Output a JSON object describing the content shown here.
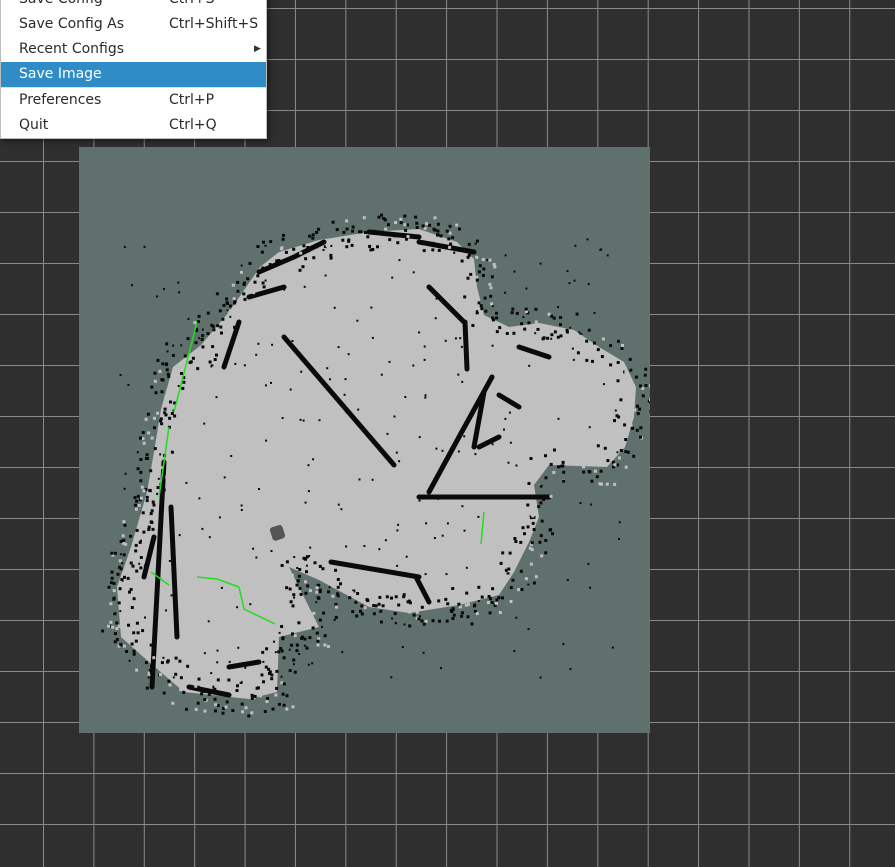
{
  "menu": {
    "items": [
      {
        "label": "Save Config",
        "shortcut": "Ctrl+S"
      },
      {
        "label": "Save Config As",
        "shortcut": "Ctrl+Shift+S"
      },
      {
        "label": "Recent Configs",
        "shortcut": "",
        "submenu": true
      },
      {
        "label": "Save Image",
        "shortcut": "",
        "highlighted": true
      },
      {
        "label": "Preferences",
        "shortcut": "Ctrl+P"
      },
      {
        "label": "Quit",
        "shortcut": "Ctrl+Q"
      }
    ]
  },
  "map": {
    "background_color": "#5f706d",
    "free_color": "#c0c0c0",
    "occupied_color": "#0a0a0a",
    "path_color": "#22dd22",
    "robot_color": "#555555"
  }
}
